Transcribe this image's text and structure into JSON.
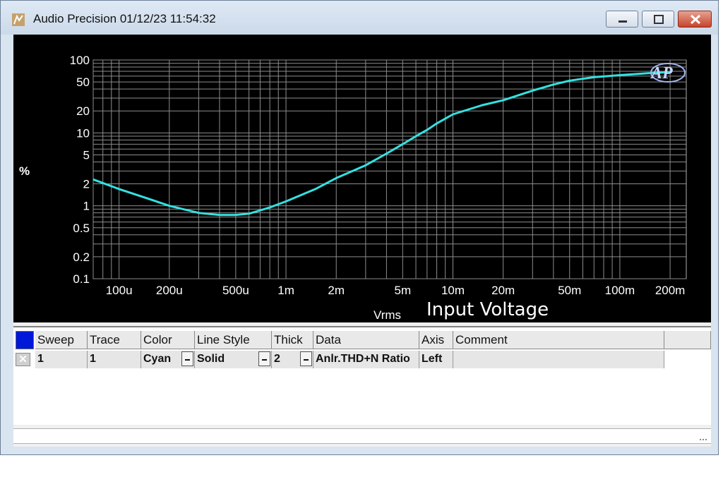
{
  "window": {
    "title": "Audio Precision  01/12/23 11:54:32",
    "icon": "audio-precision-app-icon"
  },
  "chart_data": {
    "type": "line",
    "title": "",
    "xlabel": "Vrms",
    "xlabel_extra": "Input Voltage",
    "ylabel": "%",
    "xscale": "log",
    "yscale": "log",
    "xlim": [
      7e-05,
      0.25
    ],
    "ylim": [
      0.1,
      100
    ],
    "x_ticks": [
      "100u",
      "200u",
      "500u",
      "1m",
      "2m",
      "5m",
      "10m",
      "20m",
      "50m",
      "100m",
      "200m"
    ],
    "y_ticks": [
      "100",
      "50",
      "20",
      "10",
      "5",
      "2",
      "1",
      "0.5",
      "0.2",
      "0.1"
    ],
    "grid": true,
    "series": [
      {
        "color": "#35e0e0",
        "x": [
          7e-05,
          0.0001,
          0.00015,
          0.0002,
          0.0003,
          0.0004,
          0.0005,
          0.0006,
          0.0008,
          0.001,
          0.0015,
          0.002,
          0.003,
          0.004,
          0.005,
          0.006,
          0.007,
          0.008,
          0.01,
          0.015,
          0.02,
          0.03,
          0.04,
          0.05,
          0.07,
          0.1,
          0.15,
          0.2
        ],
        "y": [
          2.3,
          1.7,
          1.25,
          1.0,
          0.8,
          0.75,
          0.75,
          0.78,
          0.95,
          1.15,
          1.7,
          2.4,
          3.6,
          5.2,
          7.0,
          9.0,
          11.0,
          13.5,
          18.0,
          24.0,
          28.0,
          38.0,
          46.0,
          52.0,
          58.0,
          62.0,
          66.0,
          68.0
        ]
      }
    ]
  },
  "table": {
    "headers": [
      "Sweep",
      "Trace",
      "Color",
      "Line Style",
      "Thick",
      "Data",
      "Axis",
      "Comment"
    ],
    "row": {
      "checked": "✕",
      "sweep": "1",
      "trace": "1",
      "color": "Cyan",
      "line_style": "Solid",
      "thick": "2",
      "data": "Anlr.THD+N Ratio",
      "axis": "Left",
      "comment": ""
    }
  }
}
